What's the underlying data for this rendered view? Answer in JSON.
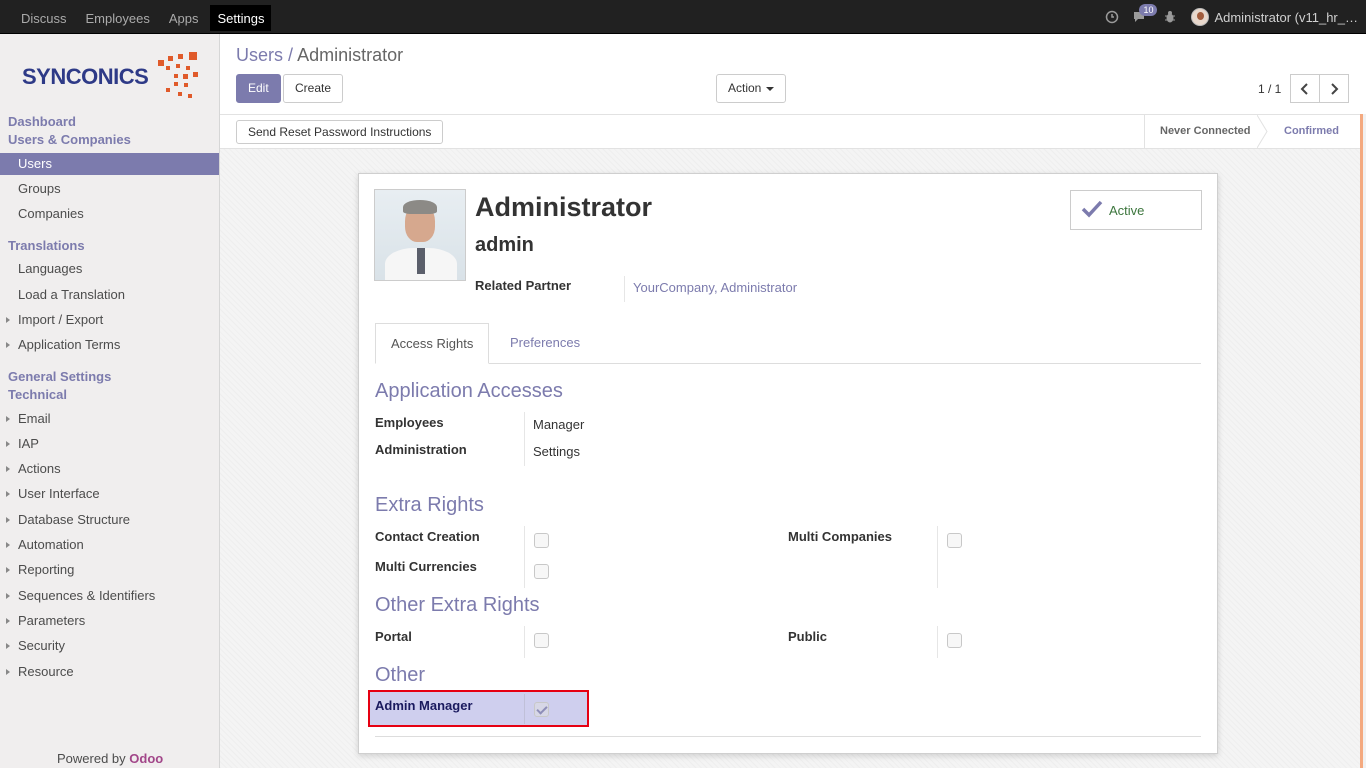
{
  "topbar": {
    "menu": [
      "Discuss",
      "Employees",
      "Apps",
      "Settings"
    ],
    "active_menu": "Settings",
    "chat_badge": "10",
    "user_label": "Administrator (v11_hr_…"
  },
  "sidebar": {
    "logo_text": "SYNCONICS",
    "heads": {
      "dashboard": "Dashboard",
      "users_companies": "Users & Companies",
      "translations": "Translations",
      "general_settings": "General Settings",
      "technical": "Technical"
    },
    "users_items": [
      "Users",
      "Groups",
      "Companies"
    ],
    "translation_items": [
      "Languages",
      "Load a Translation",
      "Import / Export",
      "Application Terms"
    ],
    "technical_items": [
      "Email",
      "IAP",
      "Actions",
      "User Interface",
      "Database Structure",
      "Automation",
      "Reporting",
      "Sequences & Identifiers",
      "Parameters",
      "Security",
      "Resource"
    ],
    "powered_prefix": "Powered by",
    "powered_brand": "Odoo"
  },
  "control": {
    "breadcrumb_parent": "Users",
    "breadcrumb_sep": "/",
    "breadcrumb_current": "Administrator",
    "edit_label": "Edit",
    "create_label": "Create",
    "action_label": "Action",
    "pager_text": "1 / 1"
  },
  "statusbar": {
    "reset_button": "Send Reset Password Instructions",
    "states": [
      "Never Connected",
      "Confirmed"
    ]
  },
  "form": {
    "name": "Administrator",
    "login": "admin",
    "active_label": "Active",
    "related_partner_label": "Related Partner",
    "related_partner_value": "YourCompany, Administrator",
    "tabs": [
      "Access Rights",
      "Preferences"
    ],
    "sections": {
      "app_access": "Application Accesses",
      "extra_rights": "Extra Rights",
      "other_extra_rights": "Other Extra Rights",
      "other": "Other"
    },
    "app_access": [
      {
        "label": "Employees",
        "value": "Manager"
      },
      {
        "label": "Administration",
        "value": "Settings"
      }
    ],
    "extra_rights": {
      "contact_creation": "Contact Creation",
      "multi_companies": "Multi Companies",
      "multi_currencies": "Multi Currencies"
    },
    "other_extra_rights": {
      "portal": "Portal",
      "public": "Public"
    },
    "other": {
      "admin_manager": "Admin Manager",
      "admin_manager_checked": true
    }
  },
  "colors": {
    "accent": "#7c7bad",
    "topbar": "#212121",
    "highlight_border": "#e60012"
  }
}
